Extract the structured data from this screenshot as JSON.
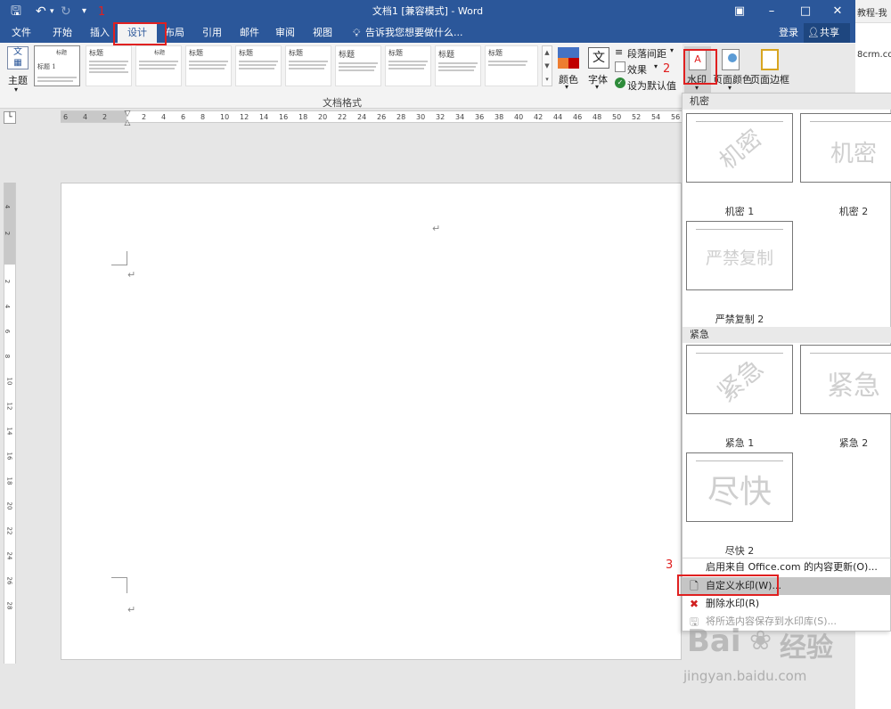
{
  "titlebar": {
    "title": "文档1 [兼容模式] - Word",
    "behind_window_text": "教程-我",
    "behind_url_text": "8crm.co"
  },
  "tabs": [
    {
      "label": "文件"
    },
    {
      "label": "开始"
    },
    {
      "label": "插入"
    },
    {
      "label": "设计"
    },
    {
      "label": "布局"
    },
    {
      "label": "引用"
    },
    {
      "label": "邮件"
    },
    {
      "label": "审阅"
    },
    {
      "label": "视图"
    }
  ],
  "tellme": "告诉我您想要做什么...",
  "login": "登录",
  "share": "共享",
  "ribbon": {
    "theme_label": "主题",
    "doc_format_label": "文档格式",
    "style_thumbs": [
      "标题",
      "标题",
      "标题",
      "标题",
      "标题",
      "标题",
      "标题",
      "标题",
      "标题",
      "标题"
    ],
    "thumb_first_title": "标题 1",
    "color_label": "颜色",
    "font_label": "字体",
    "para_spacing": "段落间距",
    "effects": "效果",
    "set_default": "设为默认值",
    "watermark": "水印",
    "page_color": "页面颜色",
    "page_border": "页面边框"
  },
  "ruler": {
    "h_numbers": [
      "6",
      "4",
      "2",
      "2",
      "4",
      "6",
      "8",
      "10",
      "12",
      "14",
      "16",
      "18",
      "20",
      "22",
      "24",
      "26",
      "28",
      "30",
      "32",
      "34",
      "36",
      "38",
      "40",
      "42",
      "44",
      "46",
      "48",
      "50",
      "52",
      "54",
      "56"
    ],
    "v_numbers": [
      "4",
      "2",
      "2",
      "4",
      "6",
      "8",
      "10",
      "12",
      "14",
      "16",
      "18",
      "20",
      "22",
      "24",
      "26",
      "28"
    ]
  },
  "dropdown": {
    "section1": "机密",
    "section2": "紧急",
    "watermarks": [
      {
        "text": "机密",
        "label": "机密 1"
      },
      {
        "text": "机密",
        "label": "机密 2"
      },
      {
        "text": "严禁复制",
        "label": "严禁复制 2"
      },
      {
        "text": "紧急",
        "label": "紧急 1"
      },
      {
        "text": "紧急",
        "label": "紧急 2"
      },
      {
        "text": "尽快",
        "label": "尽快 2"
      }
    ],
    "menu": {
      "office_update": "启用来自 Office.com 的内容更新(O)...",
      "custom": "自定义水印(W)...",
      "remove": "删除水印(R)",
      "save": "将所选内容保存到水印库(S)..."
    }
  },
  "annotations": {
    "n1": "1",
    "n2": "2",
    "n3": "3"
  },
  "brand": {
    "baidu": "Bai",
    "baidu2": "经验",
    "url": "jingyan.baidu.com"
  },
  "paragraph_mark": "↵",
  "colors": {
    "word_blue": "#2b579a",
    "highlight_red": "#e02020",
    "ribbon_bg": "#f3f3f3"
  }
}
